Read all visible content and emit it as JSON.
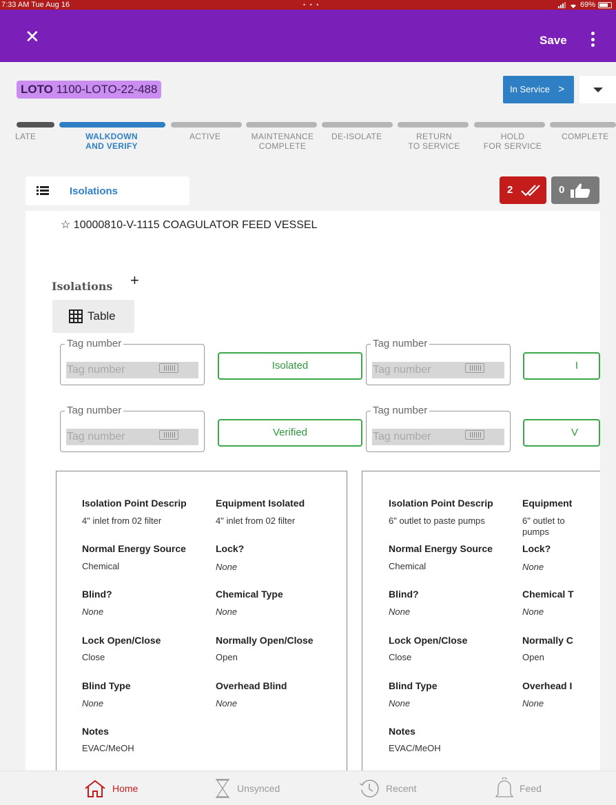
{
  "status_bar": {
    "time": "7:33 AM  Tue Aug 16",
    "dots": "• • •",
    "battery": "69%"
  },
  "app_bar": {
    "close_icon": "close-icon",
    "save_label": "Save",
    "more_icon": "more-vertical-icon"
  },
  "record": {
    "type": "LOTO",
    "id": "1100-LOTO-22-488",
    "status_button": "In Service",
    "status_chevron": ">"
  },
  "stepper": {
    "steps": [
      {
        "label": "LATE"
      },
      {
        "label": "WALKDOWN\nAND VERIFY",
        "active": true
      },
      {
        "label": "ACTIVE"
      },
      {
        "label": "MAINTENANCE\nCOMPLETE"
      },
      {
        "label": "DE-ISOLATE"
      },
      {
        "label": "RETURN\nTO SERVICE"
      },
      {
        "label": "HOLD\nFOR SERVICE"
      },
      {
        "label": "COMPLETE"
      }
    ],
    "active_color": "#2f7fc4",
    "done_color": "#555555"
  },
  "section": {
    "tab_label": "Isolations",
    "verified_count": "2",
    "like_count": "0"
  },
  "equipment": {
    "star_icon": "star-outline-icon",
    "title": "10000810-V-1115  COAGULATOR FEED VESSEL"
  },
  "isolations": {
    "heading": "Isolations",
    "add_icon": "+",
    "table_label": "Table",
    "tag_legend": "Tag number",
    "tag_placeholder": "Tag number",
    "isolated_label": "Isolated",
    "verified_label": "Verified",
    "isolated_label_clipped": "I",
    "verified_label_clipped": "V"
  },
  "cards": [
    {
      "isolation_point_label": "Isolation Point Descrip",
      "isolation_point_value": "4\" inlet from 02 filter",
      "equipment_label": "Equipment Isolated",
      "equipment_value": "4\" inlet from 02 filter",
      "energy_label": "Normal Energy Source",
      "energy_value": "Chemical",
      "lock_label": "Lock?",
      "lock_value": "None",
      "blind_label": "Blind?",
      "blind_value": "None",
      "chem_label": "Chemical Type",
      "chem_value": "None",
      "lock_oc_label": "Lock Open/Close",
      "lock_oc_value": "Close",
      "norm_oc_label": "Normally Open/Close",
      "norm_oc_value": "Open",
      "blind_type_label": "Blind Type",
      "blind_type_value": "None",
      "overhead_label": "Overhead Blind",
      "overhead_value": "None",
      "notes_label": "Notes",
      "notes_value": "EVAC/MeOH"
    },
    {
      "isolation_point_label": "Isolation Point Descrip",
      "isolation_point_value": "6\" outlet to paste pumps",
      "equipment_label": "Equipment",
      "equipment_value": "6\" outlet to pumps",
      "energy_label": "Normal Energy Source",
      "energy_value": "Chemical",
      "lock_label": "Lock?",
      "lock_value": "None",
      "blind_label": "Blind?",
      "blind_value": "None",
      "chem_label": "Chemical T",
      "chem_value": "None",
      "lock_oc_label": "Lock Open/Close",
      "lock_oc_value": "Close",
      "norm_oc_label": "Normally C",
      "norm_oc_value": "Open",
      "blind_type_label": "Blind Type",
      "blind_type_value": "None",
      "overhead_label": "Overhead I",
      "overhead_value": "None",
      "notes_label": "Notes",
      "notes_value": "EVAC/MeOH"
    }
  ],
  "tab_bar": {
    "home": "Home",
    "unsynced": "Unsynced",
    "recent": "Recent",
    "feed": "Feed",
    "active_color": "#c41b1b"
  }
}
